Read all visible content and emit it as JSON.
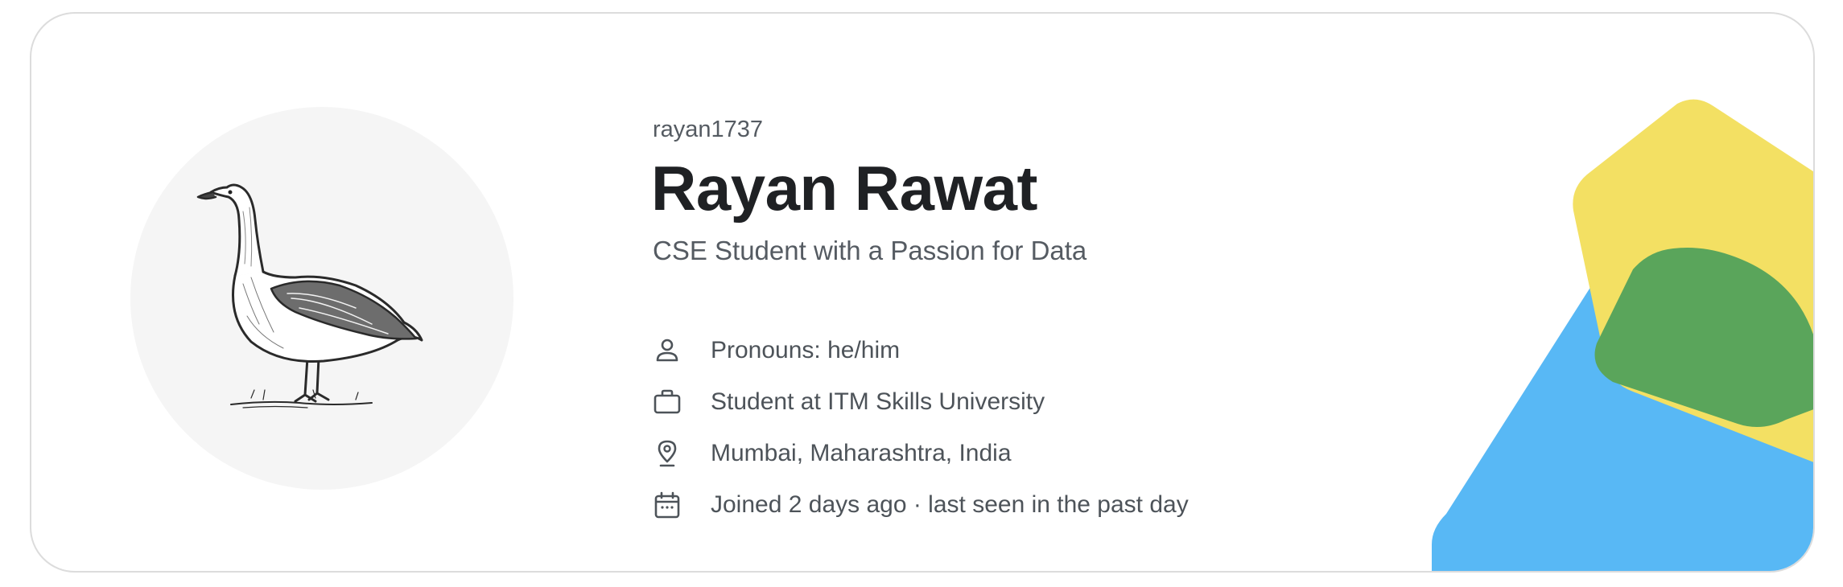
{
  "profile": {
    "username": "rayan1737",
    "name": "Rayan Rawat",
    "headline": "CSE Student with a Passion for Data",
    "pronouns": "Pronouns: he/him",
    "occupation": "Student at ITM Skills University",
    "location": "Mumbai, Maharashtra, India",
    "activity": "Joined 2 days ago · last seen in the past day",
    "avatar_icon": "goose-illustration"
  },
  "icons": {
    "pronouns": "person-icon",
    "occupation": "briefcase-icon",
    "location": "location-pin-icon",
    "activity": "calendar-icon"
  },
  "colors": {
    "text_primary": "#1f2124",
    "text_secondary": "#555b62",
    "avatar_bg": "#f5f5f5",
    "decor_yellow": "#f3e063",
    "decor_green": "#5aa55b",
    "decor_blue": "#58b8f5"
  }
}
